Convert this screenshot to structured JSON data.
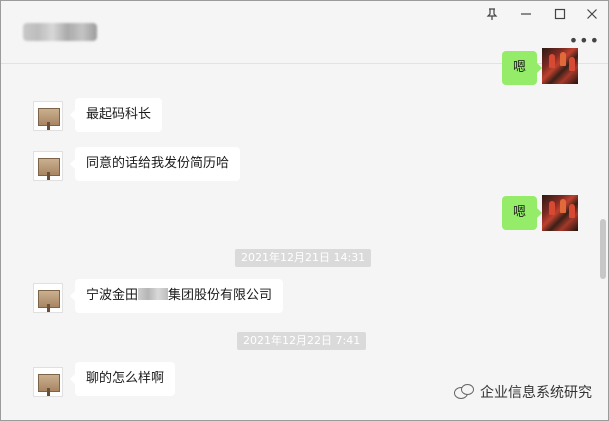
{
  "window": {
    "controls": {
      "pin": "⊥",
      "minimize": "—",
      "maximize": "☐",
      "close": "✕"
    },
    "more_label": "•••"
  },
  "messages": [
    {
      "side": "right",
      "text": "嗯"
    },
    {
      "side": "left",
      "text": "最起码科长"
    },
    {
      "side": "left",
      "text": "同意的话给我发份简历哈"
    },
    {
      "side": "right",
      "text": "嗯"
    },
    {
      "type": "time",
      "text": "2021年12月21日 14:31"
    },
    {
      "side": "left",
      "text_before": "宁波金田",
      "text_after": "集团股份有限公司"
    },
    {
      "type": "time",
      "text": "2021年12月22日 7:41"
    },
    {
      "side": "left",
      "text": "聊的怎么样啊"
    }
  ],
  "watermark": {
    "text": "企业信息系统研究",
    "icon": "wechat-icon"
  }
}
